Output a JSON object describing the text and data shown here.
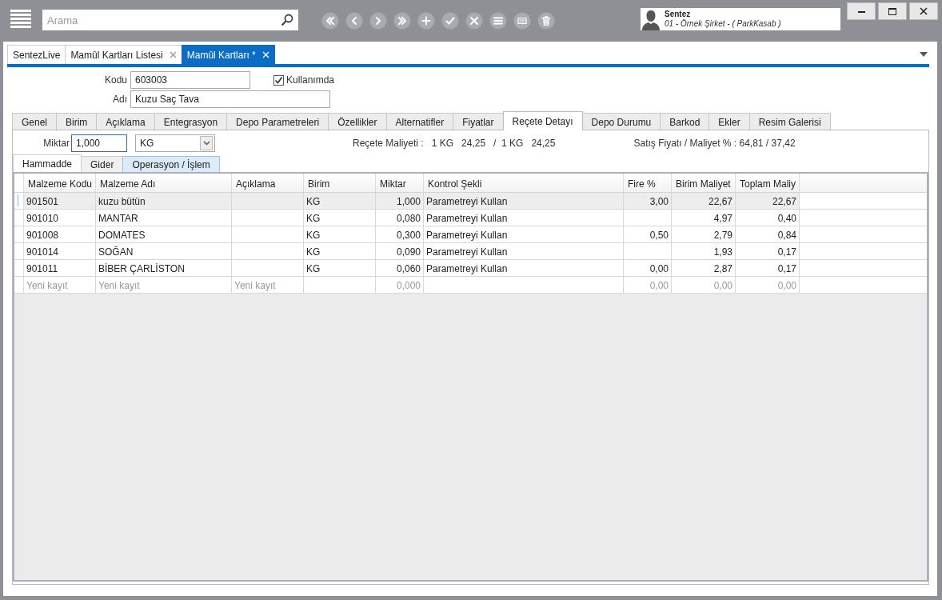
{
  "toolbar": {
    "search": {
      "placeholder": "Arama"
    }
  },
  "user": {
    "name": "Sentez",
    "company": "01 - Örnek Şirket - ( ParkKasab )"
  },
  "doc_tabs": [
    {
      "label": "SentezLive",
      "selected": false,
      "closable": false
    },
    {
      "label": "Mamûl Kartları Listesi",
      "selected": false,
      "closable": true
    },
    {
      "label": "Mamûl Kartları *",
      "selected": true,
      "closable": true
    }
  ],
  "form": {
    "code_label": "Kodu",
    "code": "603003",
    "in_use": {
      "label": "Kullanımda",
      "checked": true
    },
    "name_label": "Adı",
    "name": "Kuzu Saç Tava"
  },
  "tabs": [
    {
      "label": "Genel",
      "selected": false
    },
    {
      "label": "Birim",
      "selected": false
    },
    {
      "label": "Açıklama",
      "selected": false
    },
    {
      "label": "Entegrasyon",
      "selected": false
    },
    {
      "label": "Depo Parametreleri",
      "selected": false
    },
    {
      "label": "Özellikler",
      "selected": false
    },
    {
      "label": "Alternatifler",
      "selected": false
    },
    {
      "label": "Fiyatlar",
      "selected": false
    },
    {
      "label": "Reçete Detayı",
      "selected": true
    },
    {
      "label": "Depo Durumu",
      "selected": false
    },
    {
      "label": "Barkod",
      "selected": false
    },
    {
      "label": "Ekler",
      "selected": false
    },
    {
      "label": "Resim Galerisi",
      "selected": false
    }
  ],
  "recipe": {
    "quantity_label": "Miktar",
    "quantity": "1,000",
    "unit": "KG",
    "cost": "Reçete Maliyeti :   1 KG   24,25   /  1 KG   24,25",
    "ratio": "Satış Fiyatı / Maliyet % : 64,81 / 37,42"
  },
  "sub_tabs": [
    {
      "label": "Hammadde",
      "selected": true,
      "highlighted": false
    },
    {
      "label": "Gider",
      "selected": false,
      "highlighted": false
    },
    {
      "label": "Operasyon / İşlem",
      "selected": false,
      "highlighted": true
    }
  ],
  "table": {
    "columns": [
      {
        "label": "Malzeme Kodu",
        "numeric": false
      },
      {
        "label": "Malzeme Adı",
        "numeric": false
      },
      {
        "label": "Açıklama",
        "numeric": false
      },
      {
        "label": "Birim",
        "numeric": false
      },
      {
        "label": "Miktar",
        "numeric": true
      },
      {
        "label": "Kontrol Şekli",
        "numeric": false
      },
      {
        "label": "Fire %",
        "numeric": true
      },
      {
        "label": "Birim Maliyet",
        "numeric": true
      },
      {
        "label": "Toplam Maliy",
        "numeric": true
      }
    ],
    "rows": [
      {
        "kind": "item",
        "selected": true,
        "cells": [
          "901501",
          "kuzu bütün",
          null,
          "KG",
          "1,000",
          "Parametreyi Kullan",
          "3,00",
          "22,67",
          "22,67"
        ]
      },
      {
        "kind": "item",
        "selected": false,
        "cells": [
          "901010",
          "MANTAR",
          null,
          "KG",
          "0,080",
          "Parametreyi Kullan",
          null,
          "4,97",
          "0,40"
        ]
      },
      {
        "kind": "item",
        "selected": false,
        "cells": [
          "901008",
          "DOMATES",
          null,
          "KG",
          "0,300",
          "Parametreyi Kullan",
          "0,50",
          "2,79",
          "0,84"
        ]
      },
      {
        "kind": "item",
        "selected": false,
        "cells": [
          "901014",
          "SOĞAN",
          null,
          "KG",
          "0,090",
          "Parametreyi Kullan",
          null,
          "1,93",
          "0,17"
        ]
      },
      {
        "kind": "item",
        "selected": false,
        "cells": [
          "901011",
          "BİBER ÇARLİSTON",
          null,
          "KG",
          "0,060",
          "Parametreyi Kullan",
          "0,00",
          "2,87",
          "0,17"
        ]
      },
      {
        "kind": "new",
        "selected": false,
        "cells": [
          "Yeni kayıt",
          "Yeni kayıt",
          "Yeni kayıt",
          null,
          "0,000",
          null,
          "0,00",
          "0,00",
          "0,00"
        ]
      }
    ]
  }
}
